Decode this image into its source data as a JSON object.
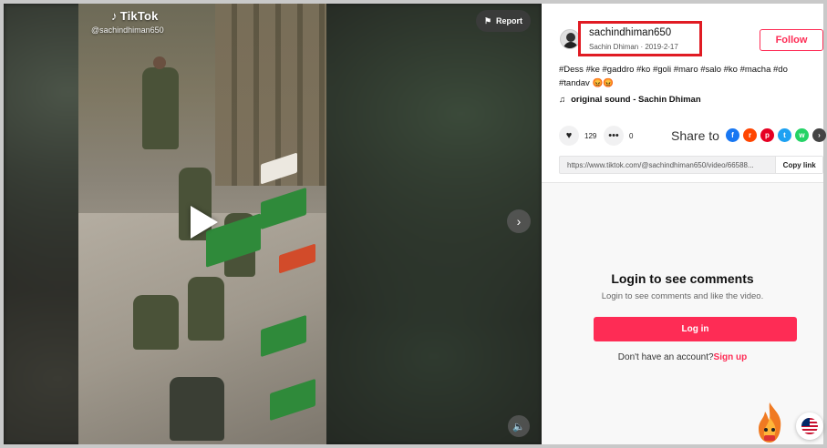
{
  "video": {
    "brand": "TikTok",
    "handle": "@sachindhiman650",
    "report_label": "Report",
    "icons": {
      "play": "play-icon",
      "report": "flag-icon",
      "next": "chevron-right-icon",
      "mute": "speaker-icon"
    }
  },
  "author": {
    "username": "sachindhiman650",
    "display_name": "Sachin Dhiman",
    "separator": " · ",
    "date": "2019-2-17",
    "highlight_color": "#e01b23"
  },
  "follow_label": "Follow",
  "caption": "#Dess #ke #gaddro #ko #goli #maro #salo #ko #macha #do #tandav 😡😡",
  "sound": {
    "icon": "music-note-icon",
    "label": "original sound - Sachin Dhiman"
  },
  "stats": {
    "likes": "129",
    "comments": "0"
  },
  "share": {
    "label": "Share to",
    "targets": [
      {
        "icon": "facebook-icon",
        "glyph": "f",
        "color": "#1877f2"
      },
      {
        "icon": "reddit-icon",
        "glyph": "r",
        "color": "#ff4500"
      },
      {
        "icon": "pinterest-icon",
        "glyph": "p",
        "color": "#e60023"
      },
      {
        "icon": "twitter-icon",
        "glyph": "t",
        "color": "#1da1f2"
      },
      {
        "icon": "whatsapp-icon",
        "glyph": "w",
        "color": "#25d366"
      },
      {
        "icon": "more-share-icon",
        "glyph": "›",
        "color": "#444444"
      }
    ]
  },
  "link": {
    "url": "https://www.tiktok.com/@sachindhiman650/video/66588...",
    "copy_label": "Copy link"
  },
  "comments": {
    "title": "Login to see comments",
    "subtitle": "Login to see comments and like the video.",
    "login_label": "Log in",
    "no_account_text": "Don't have an account?",
    "signup_label": "Sign up"
  },
  "accent_color": "#fe2c55",
  "region_icon": "us-flag-icon"
}
